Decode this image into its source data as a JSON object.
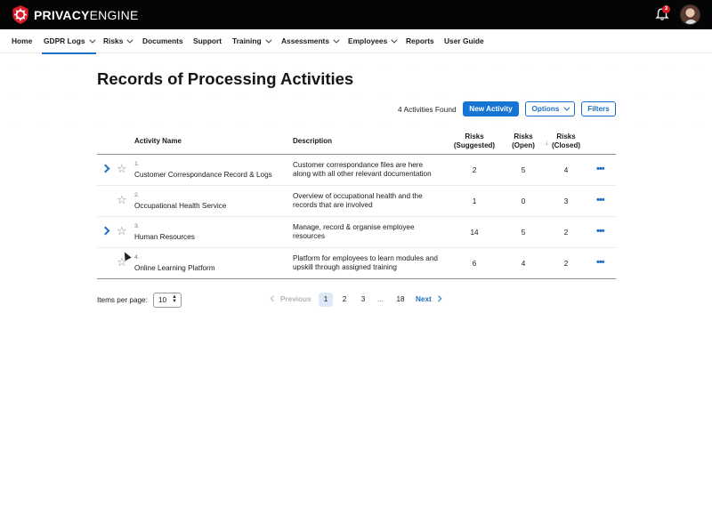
{
  "brand": {
    "name_bold": "PRIVACY",
    "name_light": "ENGINE"
  },
  "header": {
    "notifications_count": "3"
  },
  "nav": [
    {
      "label": "Home",
      "has_dropdown": false
    },
    {
      "label": "GDPR Logs",
      "has_dropdown": true,
      "active": true
    },
    {
      "label": "Risks",
      "has_dropdown": true
    },
    {
      "label": "Documents",
      "has_dropdown": false
    },
    {
      "label": "Support",
      "has_dropdown": false
    },
    {
      "label": "Training",
      "has_dropdown": true
    },
    {
      "label": "Assessments",
      "has_dropdown": true
    },
    {
      "label": "Employees",
      "has_dropdown": true
    },
    {
      "label": "Reports",
      "has_dropdown": false
    },
    {
      "label": "User Guide",
      "has_dropdown": false
    }
  ],
  "page": {
    "title": "Records of Processing Activities"
  },
  "toolbar": {
    "found_text": "4 Activities Found",
    "new_activity": "New Activity",
    "options": "Options",
    "filters": "Filters"
  },
  "table": {
    "headers": {
      "name": "Activity Name",
      "description": "Description",
      "risks_suggested_1": "Risks",
      "risks_suggested_2": "(Suggested)",
      "risks_open_1": "Risks",
      "risks_open_2": "(Open)",
      "risks_closed_1": "Risks",
      "risks_closed_2": "(Closed)",
      "sort_indicator": "↓"
    },
    "rows": [
      {
        "num": "1.",
        "name": "Customer Correspondance Record & Logs",
        "description": "Customer correspondance files are here along with all other relevant documentation",
        "suggested": "2",
        "open": "5",
        "closed": "4",
        "expandable": true
      },
      {
        "num": "2.",
        "name": "Occupational Health Service",
        "description": "Overview of occupational health and the records that are involved",
        "suggested": "1",
        "open": "0",
        "closed": "3",
        "expandable": false
      },
      {
        "num": "3.",
        "name": "Human Resources",
        "description": "Manage, record & organise employee resources",
        "suggested": "14",
        "open": "5",
        "closed": "2",
        "expandable": true
      },
      {
        "num": "4.",
        "name": "Online Learning Platform",
        "description": "Platform for employees to learn modules and upskill through assigned training",
        "suggested": "6",
        "open": "4",
        "closed": "2",
        "expandable": false
      }
    ],
    "more_glyph": "•••",
    "star_glyph": "☆"
  },
  "pagination": {
    "items_per_page_label": "Items per page:",
    "items_per_page_value": "10",
    "previous": "Previous",
    "pages": [
      "1",
      "2",
      "3"
    ],
    "ellipsis": "...",
    "last_page": "18",
    "next": "Next",
    "current_page": "1"
  },
  "colors": {
    "accent": "#1574d4",
    "topbar": "#050505",
    "badge": "#d81e2a",
    "active_page_bg": "#dde9f7"
  },
  "icons": {
    "logo": "privacy-engine-logo-icon",
    "bell": "bell-icon",
    "star": "star-outline-icon",
    "expand": "chevron-right-icon",
    "more": "more-dots-icon"
  }
}
